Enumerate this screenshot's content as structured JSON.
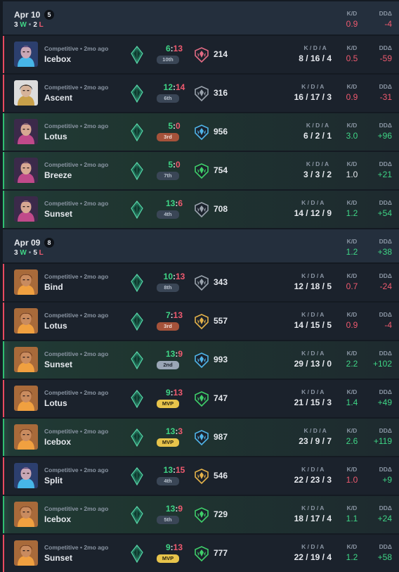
{
  "labels": {
    "kda": "K / D / A",
    "kd": "K/D",
    "dd": "DDΔ",
    "win_suffix": "W",
    "loss_suffix": "L",
    "dot": "•"
  },
  "days": [
    {
      "date": "Apr 10",
      "count": "5",
      "wins": "3",
      "losses": "2",
      "kd": "0.9",
      "kd_tone": "neg",
      "dd": "-4",
      "dd_tone": "neg",
      "matches": [
        {
          "agent": "reyna",
          "mode": "Competitive • 2mo ago",
          "map": "Icebox",
          "score_a": "6",
          "score_b": "13",
          "result": "loss",
          "place": "10th",
          "place_style": "norm",
          "rank_color": "#e36b84",
          "rr": "214",
          "kda": "8 / 16 / 4",
          "kd": "0.5",
          "kd_tone": "neg",
          "dd": "-59",
          "dd_tone": "neg"
        },
        {
          "agent": "chamber",
          "mode": "Competitive • 2mo ago",
          "map": "Ascent",
          "score_a": "12",
          "score_b": "14",
          "result": "loss",
          "place": "6th",
          "place_style": "norm",
          "rank_color": "#9aa3ad",
          "rr": "316",
          "kda": "16 / 17 / 3",
          "kd": "0.9",
          "kd_tone": "neg",
          "dd": "-31",
          "dd_tone": "neg"
        },
        {
          "agent": "clove",
          "mode": "Competitive • 2mo ago",
          "map": "Lotus",
          "score_a": "5",
          "score_b": "0",
          "result": "win",
          "place": "3rd",
          "place_style": "bronze",
          "rank_color": "#4fb4e8",
          "rr": "956",
          "kda": "6 / 2 / 1",
          "kd": "3.0",
          "kd_tone": "pos",
          "dd": "+96",
          "dd_tone": "pos"
        },
        {
          "agent": "clove",
          "mode": "Competitive • 2mo ago",
          "map": "Breeze",
          "score_a": "5",
          "score_b": "0",
          "result": "win",
          "place": "7th",
          "place_style": "norm",
          "rank_color": "#3fcf6a",
          "rr": "754",
          "kda": "3 / 3 / 2",
          "kd": "1.0",
          "kd_tone": "neu",
          "dd": "+21",
          "dd_tone": "pos"
        },
        {
          "agent": "clove",
          "mode": "Competitive • 2mo ago",
          "map": "Sunset",
          "score_a": "13",
          "score_b": "6",
          "result": "win",
          "place": "4th",
          "place_style": "norm",
          "rank_color": "#9aa3ad",
          "rr": "708",
          "kda": "14 / 12 / 9",
          "kd": "1.2",
          "kd_tone": "pos",
          "dd": "+54",
          "dd_tone": "pos"
        }
      ]
    },
    {
      "date": "Apr 09",
      "count": "8",
      "wins": "3",
      "losses": "5",
      "kd": "1.2",
      "kd_tone": "pos",
      "dd": "+38",
      "dd_tone": "pos",
      "matches": [
        {
          "agent": "raze",
          "mode": "Competitive • 2mo ago",
          "map": "Bind",
          "score_a": "10",
          "score_b": "13",
          "result": "loss",
          "place": "8th",
          "place_style": "norm",
          "rank_color": "#9aa3ad",
          "rr": "343",
          "kda": "12 / 18 / 5",
          "kd": "0.7",
          "kd_tone": "neg",
          "dd": "-24",
          "dd_tone": "neg"
        },
        {
          "agent": "raze",
          "mode": "Competitive • 2mo ago",
          "map": "Lotus",
          "score_a": "7",
          "score_b": "13",
          "result": "loss",
          "place": "3rd",
          "place_style": "bronze",
          "rank_color": "#e4b24a",
          "rr": "557",
          "kda": "14 / 15 / 5",
          "kd": "0.9",
          "kd_tone": "neg",
          "dd": "-4",
          "dd_tone": "neg"
        },
        {
          "agent": "raze",
          "mode": "Competitive • 2mo ago",
          "map": "Sunset",
          "score_a": "13",
          "score_b": "9",
          "result": "win",
          "place": "2nd",
          "place_style": "silver",
          "rank_color": "#4fb4e8",
          "rr": "993",
          "kda": "29 / 13 / 0",
          "kd": "2.2",
          "kd_tone": "pos",
          "dd": "+102",
          "dd_tone": "pos"
        },
        {
          "agent": "raze",
          "mode": "Competitive • 2mo ago",
          "map": "Lotus",
          "score_a": "9",
          "score_b": "13",
          "result": "loss",
          "place": "MVP",
          "place_style": "mvp",
          "rank_color": "#3fcf6a",
          "rr": "747",
          "kda": "21 / 15 / 3",
          "kd": "1.4",
          "kd_tone": "pos",
          "dd": "+49",
          "dd_tone": "pos"
        },
        {
          "agent": "raze",
          "mode": "Competitive • 2mo ago",
          "map": "Icebox",
          "score_a": "13",
          "score_b": "3",
          "result": "win",
          "place": "MVP",
          "place_style": "mvp",
          "rank_color": "#4fb4e8",
          "rr": "987",
          "kda": "23 / 9 / 7",
          "kd": "2.6",
          "kd_tone": "pos",
          "dd": "+119",
          "dd_tone": "pos"
        },
        {
          "agent": "reyna",
          "mode": "Competitive • 2mo ago",
          "map": "Split",
          "score_a": "13",
          "score_b": "15",
          "result": "loss",
          "place": "4th",
          "place_style": "norm",
          "rank_color": "#e4b24a",
          "rr": "546",
          "kda": "22 / 23 / 3",
          "kd": "1.0",
          "kd_tone": "neg",
          "dd": "+9",
          "dd_tone": "pos"
        },
        {
          "agent": "raze",
          "mode": "Competitive • 2mo ago",
          "map": "Icebox",
          "score_a": "13",
          "score_b": "9",
          "result": "win",
          "place": "5th",
          "place_style": "norm",
          "rank_color": "#3fcf6a",
          "rr": "729",
          "kda": "18 / 17 / 4",
          "kd": "1.1",
          "kd_tone": "pos",
          "dd": "+24",
          "dd_tone": "pos"
        },
        {
          "agent": "raze",
          "mode": "Competitive • 2mo ago",
          "map": "Sunset",
          "score_a": "9",
          "score_b": "13",
          "result": "loss",
          "place": "MVP",
          "place_style": "mvp",
          "rank_color": "#3fcf6a",
          "rr": "777",
          "kda": "22 / 19 / 4",
          "kd": "1.2",
          "kd_tone": "pos",
          "dd": "+58",
          "dd_tone": "pos"
        }
      ]
    }
  ]
}
